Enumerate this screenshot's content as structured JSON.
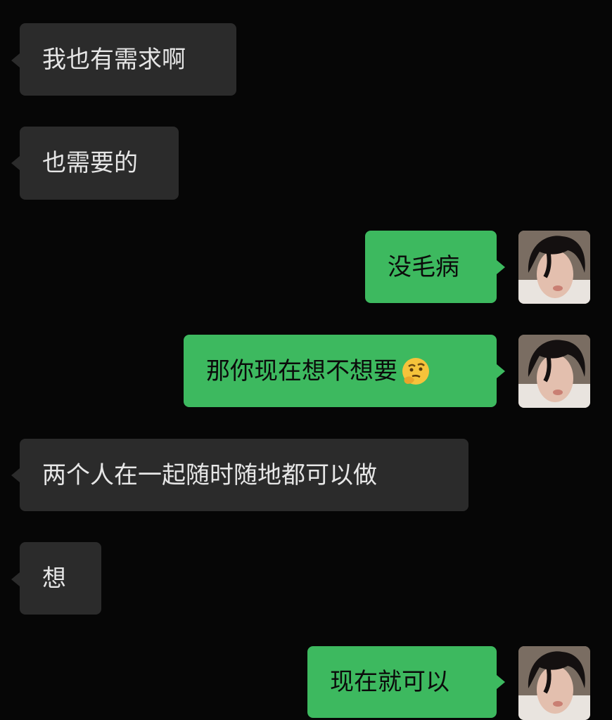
{
  "messages": [
    {
      "side": "in",
      "text": "我也有需求啊"
    },
    {
      "side": "in",
      "text": "也需要的"
    },
    {
      "side": "out",
      "text": "没毛病"
    },
    {
      "side": "out",
      "text": "那你现在想不想要",
      "emoji": "thinking-face-emoji"
    },
    {
      "side": "in",
      "text": "两个人在一起随时随地都可以做"
    },
    {
      "side": "in",
      "text": "想"
    },
    {
      "side": "out",
      "text": "现在就可以"
    }
  ],
  "colors": {
    "background": "#060606",
    "incoming_bubble": "#2b2b2b",
    "outgoing_bubble": "#3db95f"
  },
  "icons": {
    "avatar": "user-avatar-photo"
  }
}
